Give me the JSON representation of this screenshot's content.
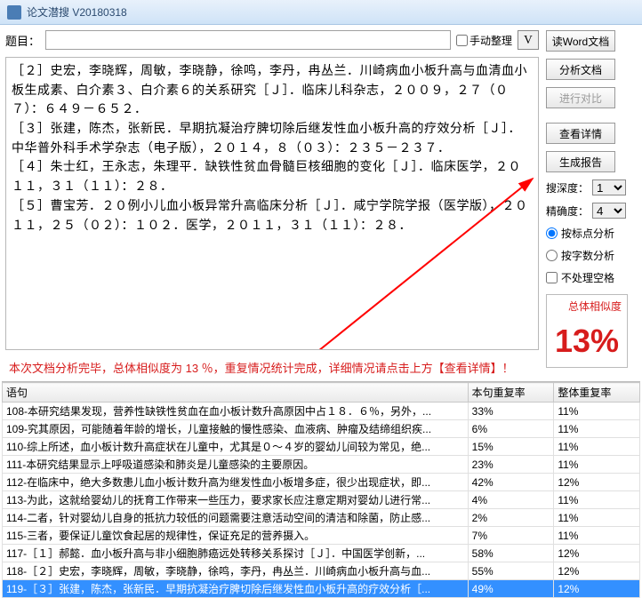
{
  "window": {
    "title": "论文潜搜 V20180318"
  },
  "toprow": {
    "label": "题目：",
    "manual_sort": "手动整理",
    "vbtn": "V"
  },
  "buttons": {
    "read_word": "读Word文档",
    "analyze": "分析文档",
    "compare": "进行对比",
    "view_detail": "查看详情",
    "gen_report": "生成报告"
  },
  "refs": [
    "［２］史宏，李晓辉，周敏，李晓静，徐鸣，李丹，冉丛兰．川崎病血小板升高与血清血小板生成素、白介素３、白介素６的关系研究［Ｊ］．临床儿科杂志，２００９，２７（０７）：６４９－６５２．",
    "［３］张建，陈杰，张新民．早期抗凝治疗脾切除后继发性血小板升高的疗效分析［Ｊ］．中华普外科手术学杂志（电子版），２０１４，８（０３）：２３５－２３７．",
    "［４］朱士红，王永志，朱理平．缺铁性贫血骨髓巨核细胞的变化［Ｊ］．临床医学，２０１１，３１（１１）：２８．",
    "［５］曹宝芳．２０例小儿血小板异常升高临床分析［Ｊ］．咸宁学院学报（医学版），２０１１，２５（０２）：１０２．医学，２０１１，３１（１１）：２８．"
  ],
  "status": "本次文档分析完毕，总体相似度为 13 ％，重复情况统计完成，详细情况请点击上方【查看详情】！",
  "controls": {
    "depth_label": "搜深度：",
    "depth_value": "1",
    "precision_label": "精确度：",
    "precision_value": "4",
    "by_punct": "按标点分析",
    "by_charcount": "按字数分析",
    "skip_space": "不处理空格"
  },
  "similarity": {
    "label": "总体相似度",
    "value": "13%"
  },
  "table": {
    "headers": {
      "phrase": "语句",
      "local": "本句重复率",
      "overall": "整体重复率"
    },
    "rows": [
      {
        "p": "108-本研究结果发现，营养性缺铁性贫血在血小板计数升高原因中占１８．６％，另外，...",
        "a": "33%",
        "b": "11%"
      },
      {
        "p": "109-究其原因，可能随着年龄的增长，儿童接触的慢性感染、血液病、肿瘤及结缔组织疾...",
        "a": "6%",
        "b": "11%"
      },
      {
        "p": "110-综上所述，血小板计数升高症状在儿童中，尤其是０～４岁的婴幼儿间较为常见，绝...",
        "a": "15%",
        "b": "11%"
      },
      {
        "p": "111-本研究结果显示上呼吸道感染和肺炎是儿童感染的主要原因。",
        "a": "23%",
        "b": "11%"
      },
      {
        "p": "112-在临床中，绝大多数患儿血小板计数升高为继发性血小板增多症，很少出现症状，即...",
        "a": "42%",
        "b": "12%"
      },
      {
        "p": "113-为此，这就给婴幼儿的抚育工作带来一些压力，要求家长应注意定期对婴幼儿进行常...",
        "a": "4%",
        "b": "11%"
      },
      {
        "p": "114-二者，针对婴幼儿自身的抵抗力较低的问题需要注意活动空间的清洁和除菌，防止感...",
        "a": "2%",
        "b": "11%"
      },
      {
        "p": "115-三者，要保证儿童饮食起居的规律性，保证充足的营养摄入。",
        "a": "7%",
        "b": "11%"
      },
      {
        "p": "117-［１］郝懿．血小板升高与非小细胞肺癌远处转移关系探讨［Ｊ］．中国医学创新，...",
        "a": "58%",
        "b": "12%"
      },
      {
        "p": "118-［２］史宏，李晓辉，周敏，李晓静，徐鸣，李丹，冉丛兰．川崎病血小板升高与血...",
        "a": "55%",
        "b": "12%"
      },
      {
        "p": "119-［３］张建，陈杰，张新民．早期抗凝治疗脾切除后继发性血小板升高的疗效分析［...",
        "a": "49%",
        "b": "12%",
        "sel": true
      }
    ]
  }
}
